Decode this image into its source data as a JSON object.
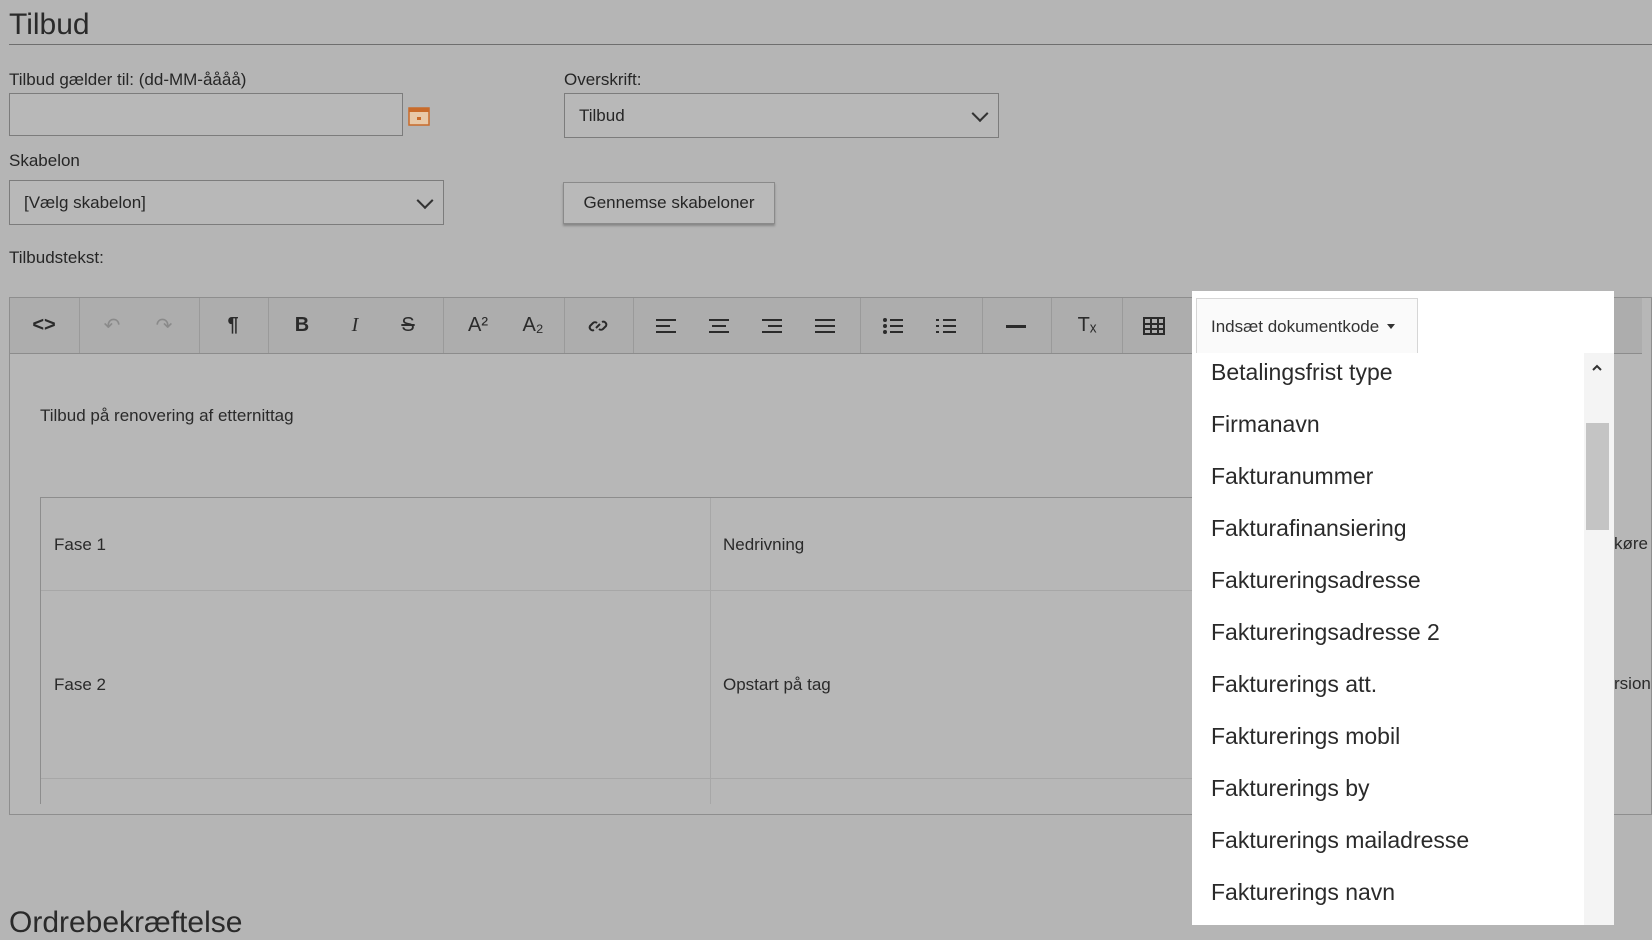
{
  "page": {
    "title": "Tilbud",
    "bottom_heading": "Ordrebekræftelse"
  },
  "form": {
    "valid_until_label": "Tilbud gælder til: (dd-MM-åååå)",
    "valid_until_value": "",
    "heading_label": "Overskrift:",
    "heading_value": "Tilbud",
    "template_label": "Skabelon",
    "template_value": "[Vælg skabelon]",
    "browse_templates_button": "Gennemse skabeloner",
    "offer_text_label": "Tilbudstekst:"
  },
  "toolbar": {
    "source_code": "<>",
    "undo": "↶",
    "redo": "↷",
    "paragraph": "¶",
    "bold": "B",
    "italic": "I",
    "strikethrough": "S",
    "superscript": "A²",
    "subscript": "A₂",
    "align_left": "≡",
    "align_center": "≡",
    "align_right": "≡",
    "justify": "≡",
    "horizontal_rule": "—",
    "clear_format": "Tₓ",
    "insert_code_label": "Indsæt dokumentkode"
  },
  "editor": {
    "intro_text": "Tilbud på renovering af etternittag",
    "table_rows": [
      {
        "c1": "Fase 1",
        "c2": "Nedrivning",
        "c3_fragment": "køre"
      },
      {
        "c1": "Fase 2",
        "c2": "Opstart på tag",
        "c3_fragment": "rsion"
      }
    ]
  },
  "insert_code_dropdown": {
    "items": [
      "Betalingsfrist type",
      "Firmanavn",
      "Fakturanummer",
      "Fakturafinansiering",
      "Faktureringsadresse",
      "Faktureringsadresse 2",
      "Fakturerings att.",
      "Fakturerings mobil",
      "Fakturerings by",
      "Fakturerings mailadresse",
      "Fakturerings navn"
    ]
  },
  "colors": {
    "overlay_bg": "#b5b5b5",
    "dropdown_bg": "#ffffff",
    "calendar_icon": "#d2691e"
  },
  "icons": [
    "calendar-icon",
    "chevron-down-icon",
    "link-icon",
    "bullet-list-icon",
    "numbered-list-icon",
    "table-icon",
    "scroll-up-icon"
  ]
}
